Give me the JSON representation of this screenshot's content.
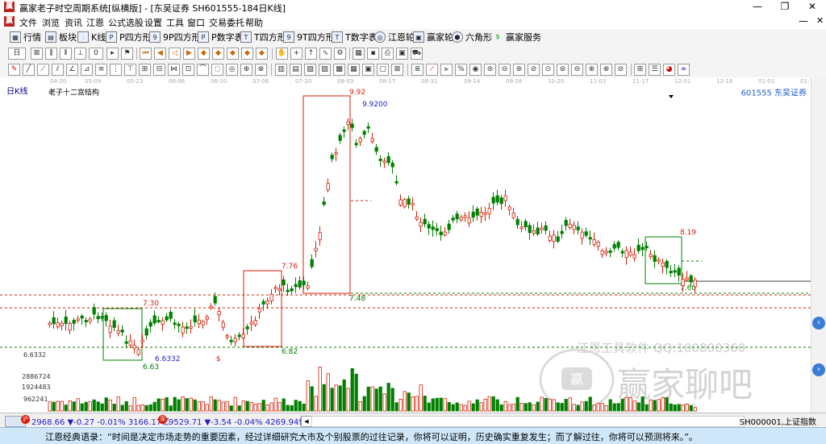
{
  "window": {
    "title": "赢家老子时空周期系统[纵横版] - [东吴证券  SH601555-184日K线]",
    "logo_text": "赢",
    "minimize_glyph": "—",
    "restore_glyph": "❐",
    "close_glyph": "✕"
  },
  "menu": {
    "items": [
      "文件",
      "浏览",
      "资讯",
      "江恩",
      "公式选股",
      "设置",
      "工具",
      "窗口",
      "交易委托",
      "帮助"
    ]
  },
  "toolbar1": {
    "items": [
      {
        "label": "行情",
        "icon": "grid-icon"
      },
      {
        "label": "板块",
        "icon": "sector-icon"
      },
      {
        "label": "K线",
        "icon": "kline-icon"
      },
      {
        "label": "P四方形",
        "icon": "p-square-icon"
      },
      {
        "label": "9P四方形",
        "icon": "9p-square-icon"
      },
      {
        "label": "P数字表",
        "icon": "p-table-icon"
      },
      {
        "label": "T四方形",
        "icon": "t-square-icon"
      },
      {
        "label": "9T四方形",
        "icon": "9t-square-icon"
      },
      {
        "label": "T数字表",
        "icon": "t-table-icon"
      },
      {
        "label": "江恩轮",
        "icon": "gann-wheel-icon"
      },
      {
        "label": "赢家轮",
        "icon": "winner-wheel-icon"
      },
      {
        "label": "六角形",
        "icon": "hexagon-icon"
      },
      {
        "label": "赢家服务",
        "icon": "dollar-icon"
      }
    ]
  },
  "toolbar2": {
    "period_value": "日",
    "zero_value": "0"
  },
  "dates": [
    "04-20",
    "05-09",
    "05-23",
    "06-06",
    "06-20",
    "07-06",
    "07-20",
    "08-03",
    "08-17",
    "08-31",
    "09-14",
    "09-28",
    "10-20",
    "11-03",
    "11-17",
    "12-01",
    "12-18",
    "01-01",
    "01-15"
  ],
  "chart_header": {
    "period_label": "日K线",
    "indicator_name": "老子十二宫结构",
    "stock_label": "601555 东吴证券"
  },
  "watermark": {
    "line1": "江恩工具软件  QQ:100800360",
    "line2": "赢家聊吧",
    "logo": "赢",
    "url": "liaoba.y...t360"
  },
  "price_axis": {
    "label": "6.6332"
  },
  "volume_axis": {
    "labels": [
      "2886724",
      "1924483",
      "962241"
    ]
  },
  "annotations": {
    "box1_high": "7.30",
    "box1_low": "6.63",
    "low_marker": "6.6332",
    "dollar": "$",
    "box2_high": "7.76",
    "box2_low": "6.82",
    "box3_high": "9.92",
    "box3_high_precise": "9.9200",
    "box3_low": "7.48",
    "box4_high": "8.19",
    "box4_low": "7.60"
  },
  "status": {
    "idx1_label": "2968.66 ▼-0.27 -0.01% 3166.17亿",
    "idx2_label": "9529.71 ▼-3.54 -0.04% 4269.94亿",
    "right_label": "SH000001,上证指数"
  },
  "quote": "江恩经典语录：“时间是决定市场走势的重要因素，经过详细研究大市及个别股票的过往记录，你将可以证明，历史确实重复发生；而了解过往，你将可以预测将来。”。",
  "colors": {
    "up": "#d81e06",
    "down": "#008000",
    "box_red": "#d81e06",
    "box_green": "#008000",
    "ma_blue": "#1e1ecc",
    "quote_bg": "#cfe7f9"
  }
}
